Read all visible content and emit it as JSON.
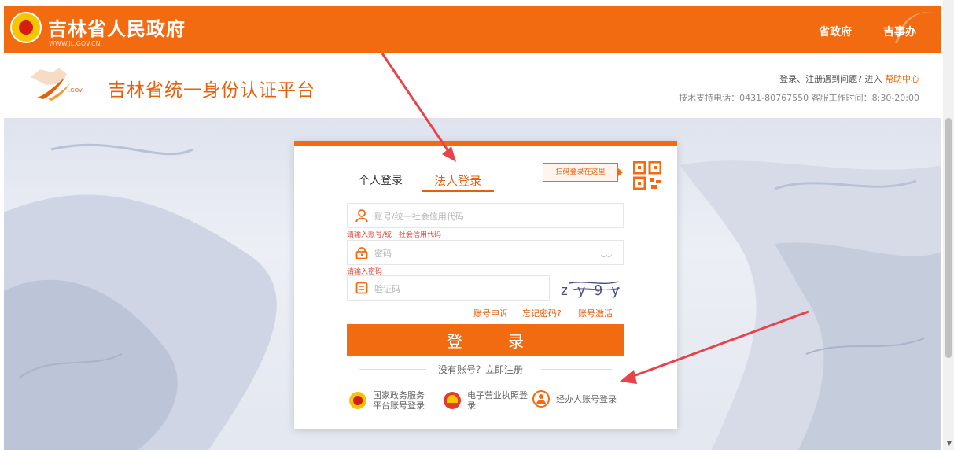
{
  "site": {
    "title": "吉林省人民政府",
    "url": "WWW.JL.GOV.CN",
    "nav": [
      "省政府",
      "吉事办"
    ]
  },
  "header": {
    "platform_title": "吉林省统一身份认证平台",
    "logo_text": ".GOV",
    "help_prefix": "登录、注册遇到问题? 进入",
    "help_link": "帮助中心",
    "support": "技术支持电话：0431-80767550  客服工作时间：8:30-20:00"
  },
  "login": {
    "tabs": [
      "个人登录",
      "法人登录"
    ],
    "active_tab": "法人登录",
    "qr_tip": "扫码登录在这里",
    "account_placeholder": "账号/统一社会信用代码",
    "account_error": "请输入账号/统一社会信用代码",
    "password_placeholder": "密码",
    "password_error": "请输入密码",
    "captcha_placeholder": "验证码",
    "captcha_text": "z y 9 y",
    "links": [
      "账号申诉",
      "忘记密码?",
      "账号激活"
    ],
    "submit_label": "登 录",
    "register": "没有账号？立即注册",
    "alt_logins": [
      "国家政务服务\n平台账号登录",
      "电子营业执照登\n录",
      "经办人账号登录"
    ]
  },
  "colors": {
    "brand_orange": "#f26b10",
    "accent_orange": "#e4600e",
    "error_red": "#e0463a",
    "annotation_arrow": "#e8434a"
  }
}
